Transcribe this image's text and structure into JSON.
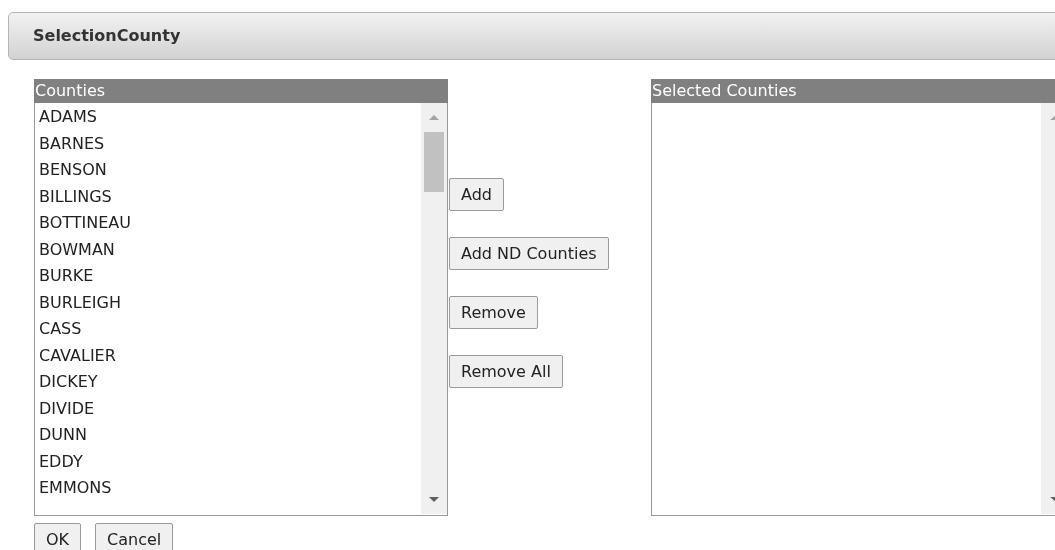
{
  "panel": {
    "title": "SelectionCounty"
  },
  "available_list": {
    "header": "Counties",
    "items": [
      "ADAMS",
      "BARNES",
      "BENSON",
      "BILLINGS",
      "BOTTINEAU",
      "BOWMAN",
      "BURKE",
      "BURLEIGH",
      "CASS",
      "CAVALIER",
      "DICKEY",
      "DIVIDE",
      "DUNN",
      "EDDY",
      "EMMONS"
    ]
  },
  "move_buttons": [
    "Add",
    "Add ND Counties",
    "Remove",
    "Remove All"
  ],
  "selected_list": {
    "header": "Selected Counties"
  },
  "dialog_buttons": [
    "OK",
    "Cancel"
  ]
}
